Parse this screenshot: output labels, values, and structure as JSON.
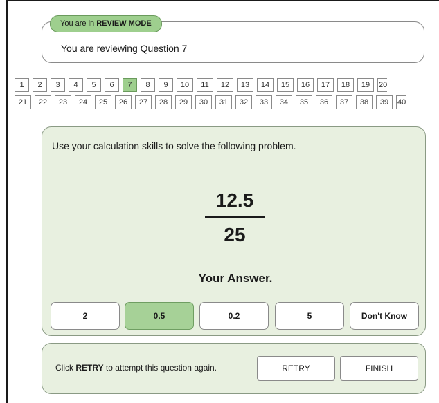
{
  "review": {
    "pill_prefix": "You are in ",
    "pill_mode": "REVIEW MODE",
    "message": "You are reviewing Question 7"
  },
  "question_nav": {
    "row1": [
      "1",
      "2",
      "3",
      "4",
      "5",
      "6",
      "7",
      "8",
      "9",
      "10",
      "11",
      "12",
      "13",
      "14",
      "15",
      "16",
      "17",
      "18",
      "19",
      "20"
    ],
    "row2": [
      "21",
      "22",
      "23",
      "24",
      "25",
      "26",
      "27",
      "28",
      "29",
      "30",
      "31",
      "32",
      "33",
      "34",
      "35",
      "36",
      "37",
      "38",
      "39",
      "40"
    ],
    "current": "7"
  },
  "question": {
    "instruction": "Use your calculation skills to solve the following problem.",
    "numerator": "12.5",
    "denominator": "25",
    "answer_label": "Your Answer."
  },
  "options": [
    {
      "label": "2",
      "selected": false
    },
    {
      "label": "0.5",
      "selected": true
    },
    {
      "label": "0.2",
      "selected": false
    },
    {
      "label": "5",
      "selected": false
    },
    {
      "label": "Don't Know",
      "selected": false
    }
  ],
  "retry": {
    "prefix": "Click ",
    "keyword": "RETRY",
    "suffix": " to attempt this question again.",
    "retry_label": "RETRY",
    "finish_label": "FINISH"
  },
  "colors": {
    "accent_green": "#9ecf8e",
    "panel_bg": "#e8f0e0"
  }
}
